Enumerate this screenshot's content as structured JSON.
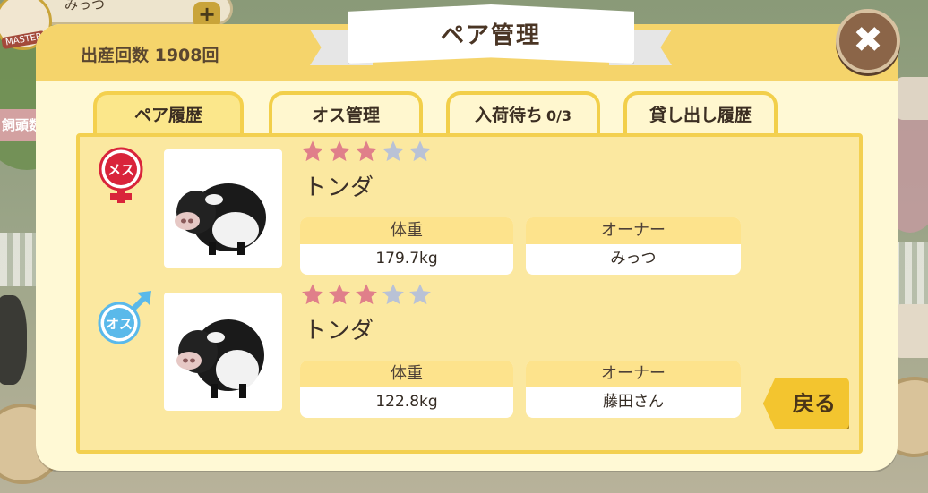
{
  "background_hud": {
    "player_name": "みっつ",
    "plus_label": "+",
    "master_badge": "MASTER",
    "side_label": "飼頭数"
  },
  "modal": {
    "title": "ペア管理",
    "birth_count": "出産回数 1908回",
    "close_label": "✖",
    "back_label": "戻る"
  },
  "tabs": [
    {
      "label": "ペア履歴",
      "active": true
    },
    {
      "label": "オス管理",
      "active": false
    },
    {
      "label": "入荷待ち",
      "count": "0/3",
      "active": false
    },
    {
      "label": "貸し出し履歴",
      "active": false
    }
  ],
  "pairs": [
    {
      "sex": "メス",
      "sex_icon": "female-icon",
      "rating": 3,
      "rating_max": 5,
      "name": "トンダ",
      "weight_label": "体重",
      "weight": "179.7kg",
      "owner_label": "オーナー",
      "owner": "みっつ"
    },
    {
      "sex": "オス",
      "sex_icon": "male-icon",
      "rating": 3,
      "rating_max": 5,
      "name": "トンダ",
      "weight_label": "体重",
      "weight": "122.8kg",
      "owner_label": "オーナー",
      "owner": "藤田さん"
    }
  ],
  "colors": {
    "star_filled": "#e07f8a",
    "star_empty": "#b9c2d6",
    "female": "#d9243a",
    "male": "#5ab9ea"
  }
}
